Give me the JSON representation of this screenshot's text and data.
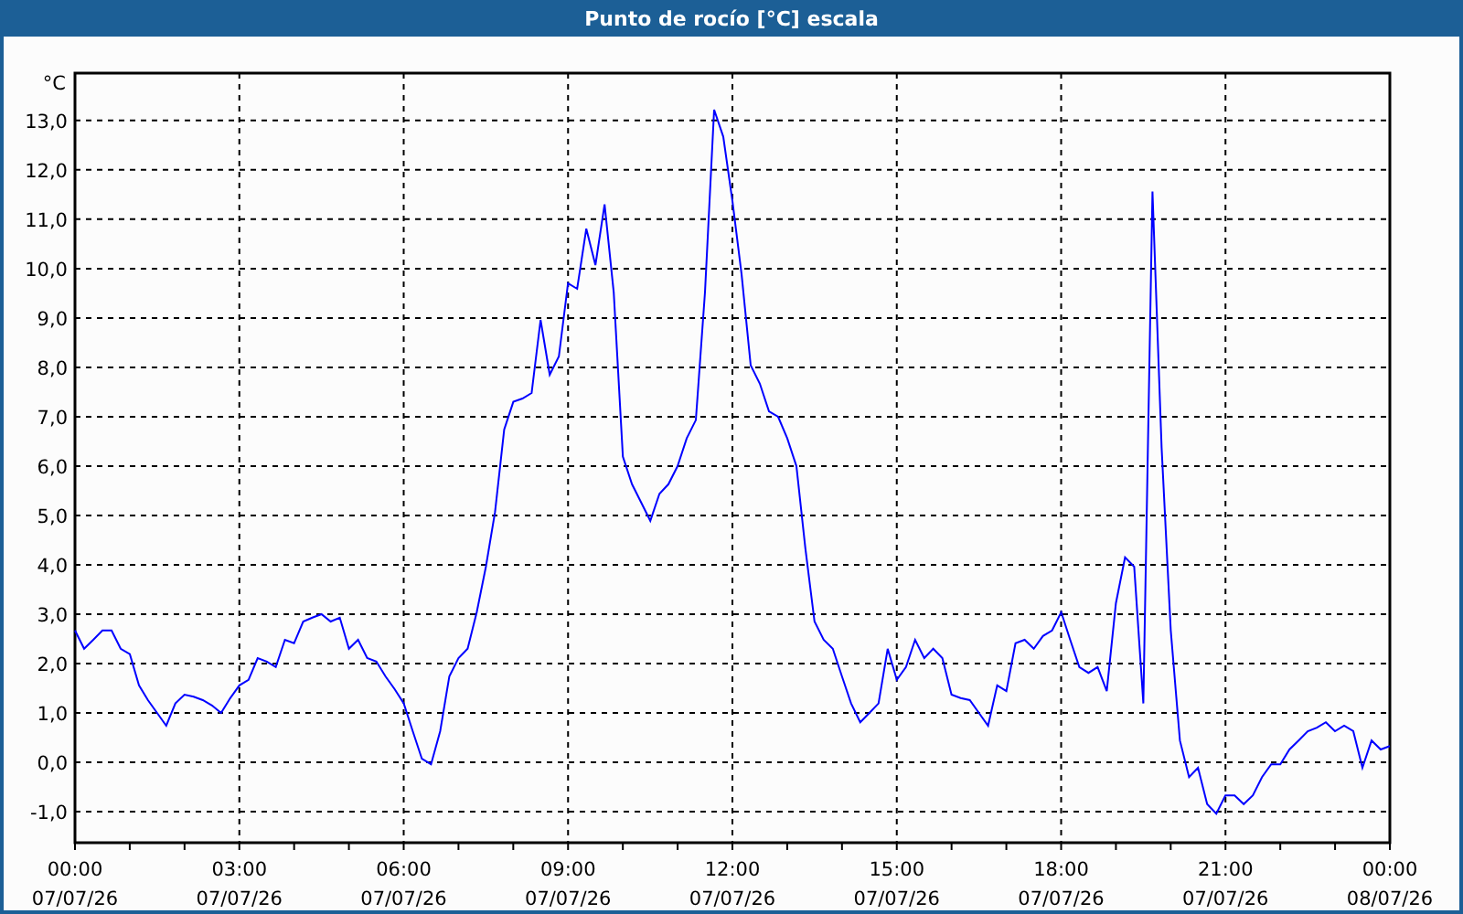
{
  "window": {
    "title": "Punto de rocío [°C] escala"
  },
  "chart": {
    "chart_data": {
      "type": "line",
      "ylabel": "°C",
      "grid": true,
      "ylim": [
        -1.63,
        13.96
      ],
      "yticks": [
        {
          "value": -1,
          "label": "-1,0"
        },
        {
          "value": 0,
          "label": "0,0"
        },
        {
          "value": 1,
          "label": "1,0"
        },
        {
          "value": 2,
          "label": "2,0"
        },
        {
          "value": 3,
          "label": "3,0"
        },
        {
          "value": 4,
          "label": "4,0"
        },
        {
          "value": 5,
          "label": "5,0"
        },
        {
          "value": 6,
          "label": "6,0"
        },
        {
          "value": 7,
          "label": "7,0"
        },
        {
          "value": 8,
          "label": "8,0"
        },
        {
          "value": 9,
          "label": "9,0"
        },
        {
          "value": 10,
          "label": "10,0"
        },
        {
          "value": 11,
          "label": "11,0"
        },
        {
          "value": 12,
          "label": "12,0"
        },
        {
          "value": 13,
          "label": "13,0"
        }
      ],
      "categories": [
        "00:00 07/07/26",
        null,
        null,
        null,
        null,
        null,
        null,
        null,
        null,
        null,
        null,
        null,
        null,
        null,
        null,
        null,
        null,
        null,
        "03:00 07/07/26",
        null,
        null,
        null,
        null,
        null,
        null,
        null,
        null,
        null,
        null,
        null,
        null,
        null,
        null,
        null,
        null,
        null,
        "06:00 07/07/26",
        null,
        null,
        null,
        null,
        null,
        null,
        null,
        null,
        null,
        null,
        null,
        null,
        null,
        null,
        null,
        null,
        null,
        "09:00 07/07/26",
        null,
        null,
        null,
        null,
        null,
        null,
        null,
        null,
        null,
        null,
        null,
        null,
        null,
        null,
        null,
        null,
        null,
        "12:00 07/07/26",
        null,
        null,
        null,
        null,
        null,
        null,
        null,
        null,
        null,
        null,
        null,
        null,
        null,
        null,
        null,
        null,
        null,
        "15:00 07/07/26",
        null,
        null,
        null,
        null,
        null,
        null,
        null,
        null,
        null,
        null,
        null,
        null,
        null,
        null,
        null,
        null,
        null,
        "18:00 07/07/26",
        null,
        null,
        null,
        null,
        null,
        null,
        null,
        null,
        null,
        null,
        null,
        null,
        null,
        null,
        null,
        null,
        null,
        "21:00 07/07/26",
        null,
        null,
        null,
        null,
        null,
        null,
        null,
        null,
        null,
        null,
        null,
        null,
        null,
        null,
        null,
        null,
        null,
        "00:00 08/07/26"
      ],
      "series": [
        {
          "color": "#0000ff",
          "values": [
            2.67,
            2.3,
            2.48,
            2.67,
            2.67,
            2.3,
            2.19,
            1.56,
            1.26,
            1.0,
            0.74,
            1.19,
            1.37,
            1.33,
            1.26,
            1.15,
            1.0,
            1.3,
            1.56,
            1.67,
            2.11,
            2.04,
            1.93,
            2.48,
            2.41,
            2.85,
            2.93,
            3.0,
            2.85,
            2.93,
            2.3,
            2.48,
            2.11,
            2.04,
            1.74,
            1.48,
            1.19,
            0.63,
            0.07,
            -0.04,
            0.63,
            1.74,
            2.11,
            2.3,
            3.04,
            3.96,
            5.07,
            6.74,
            7.3,
            7.37,
            7.48,
            8.96,
            7.85,
            8.22,
            9.7,
            9.59,
            10.81,
            10.07,
            11.3,
            9.52,
            6.19,
            5.63,
            5.26,
            4.89,
            5.44,
            5.63,
            6.0,
            6.56,
            6.93,
            9.52,
            13.22,
            12.67,
            11.37,
            9.89,
            8.04,
            7.67,
            7.11,
            7.0,
            6.56,
            6.0,
            4.33,
            2.85,
            2.48,
            2.3,
            1.74,
            1.19,
            0.81,
            1.0,
            1.19,
            2.3,
            1.67,
            1.93,
            2.48,
            2.11,
            2.3,
            2.11,
            1.37,
            1.3,
            1.26,
            1.0,
            0.74,
            1.56,
            1.44,
            2.41,
            2.48,
            2.3,
            2.56,
            2.67,
            3.04,
            2.48,
            1.93,
            1.81,
            1.93,
            1.44,
            3.22,
            4.15,
            3.96,
            1.19,
            11.56,
            6.37,
            2.67,
            0.44,
            -0.3,
            -0.11,
            -0.85,
            -1.04,
            -0.67,
            -0.67,
            -0.85,
            -0.67,
            -0.3,
            -0.04,
            -0.04,
            0.26,
            0.44,
            0.63,
            0.7,
            0.81,
            0.63,
            0.74,
            0.63,
            -0.11,
            0.44,
            0.26,
            0.33
          ]
        }
      ]
    }
  }
}
